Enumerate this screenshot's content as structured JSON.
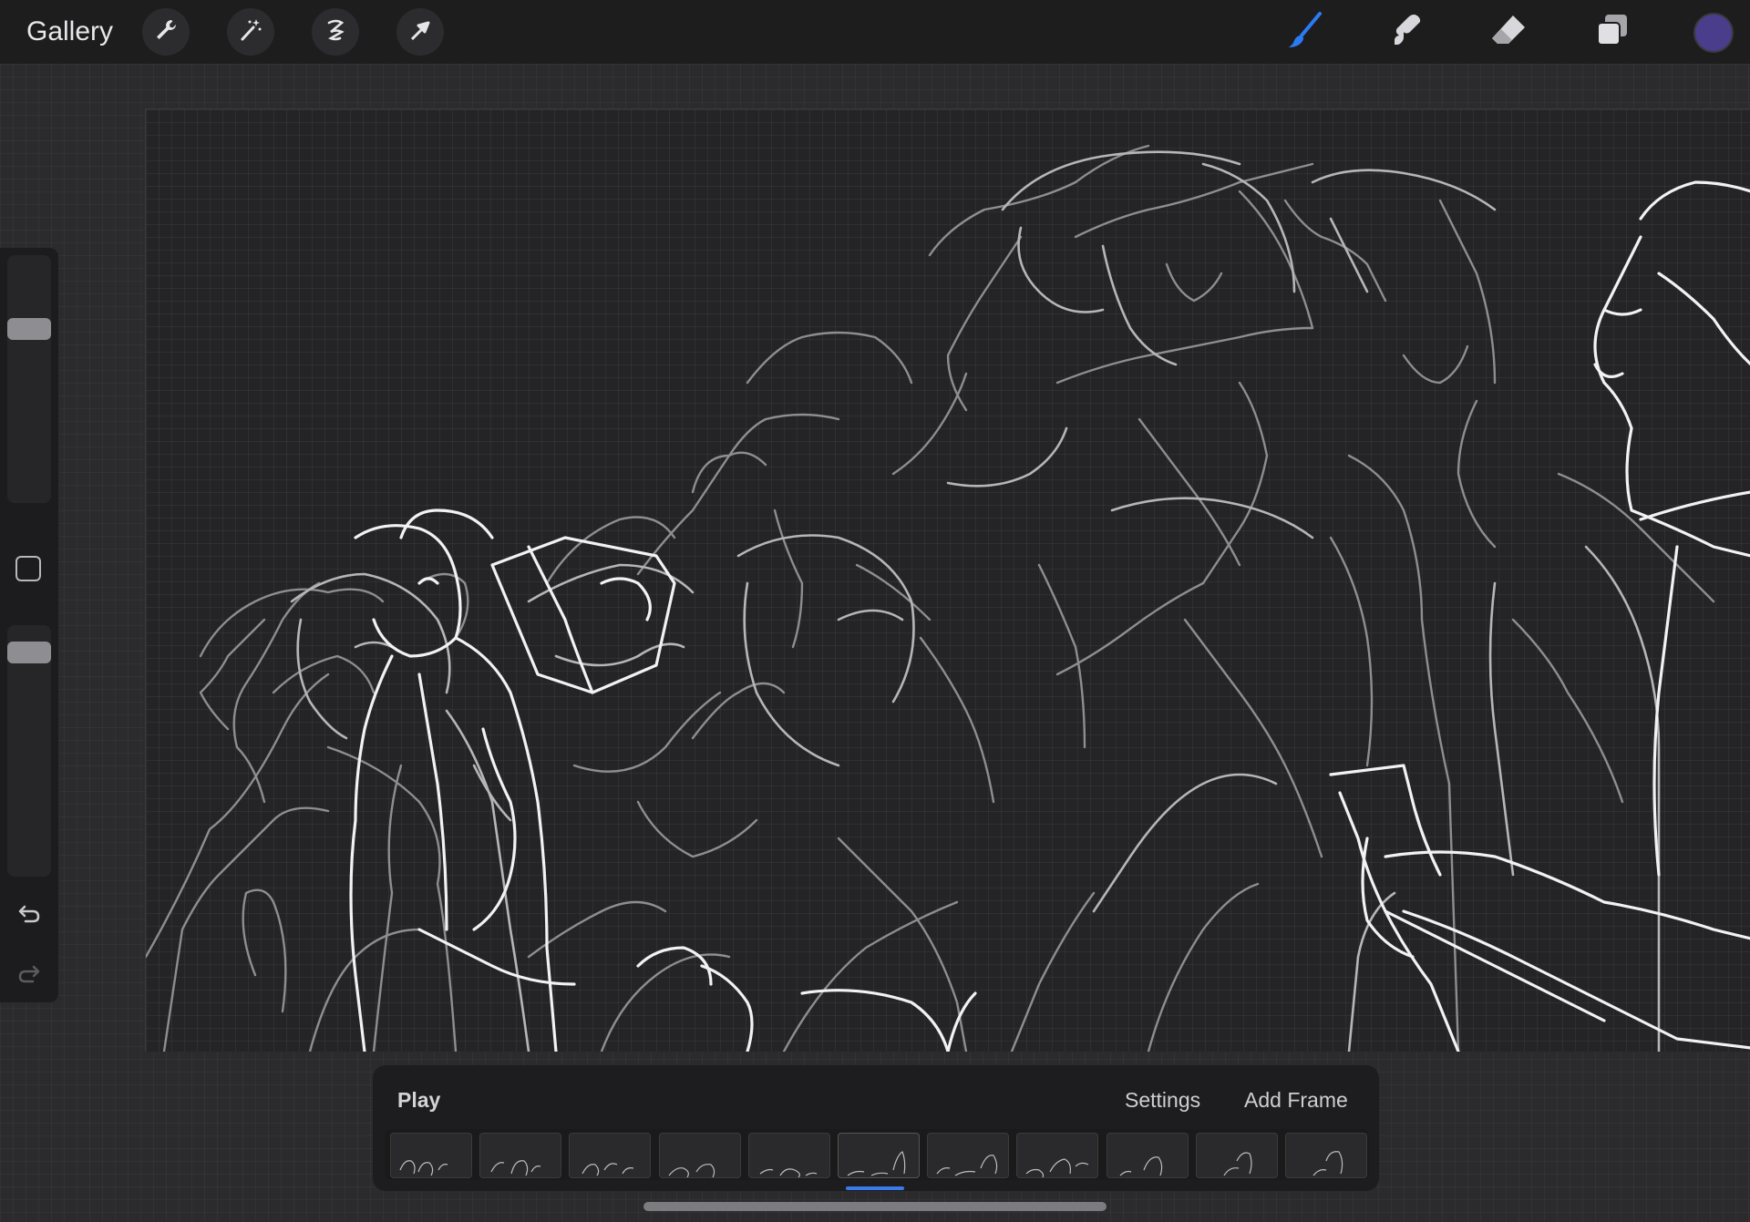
{
  "topbar": {
    "gallery_label": "Gallery",
    "left_tools": [
      "wrench-icon",
      "magic-wand-icon",
      "selection-icon",
      "transform-arrow-icon"
    ],
    "right_tools": [
      "brush-icon",
      "smudge-icon",
      "eraser-icon",
      "layers-icon"
    ],
    "active_tool": "brush",
    "active_color": "#4a3d8c",
    "brush_accent": "#2a7bf4"
  },
  "sidebar": {
    "size_slider_level": 0.72,
    "opacity_slider_level": 0.93
  },
  "timeline": {
    "play_label": "Play",
    "settings_label": "Settings",
    "add_frame_label": "Add Frame",
    "frame_count": 11,
    "selected_frame": 6
  }
}
